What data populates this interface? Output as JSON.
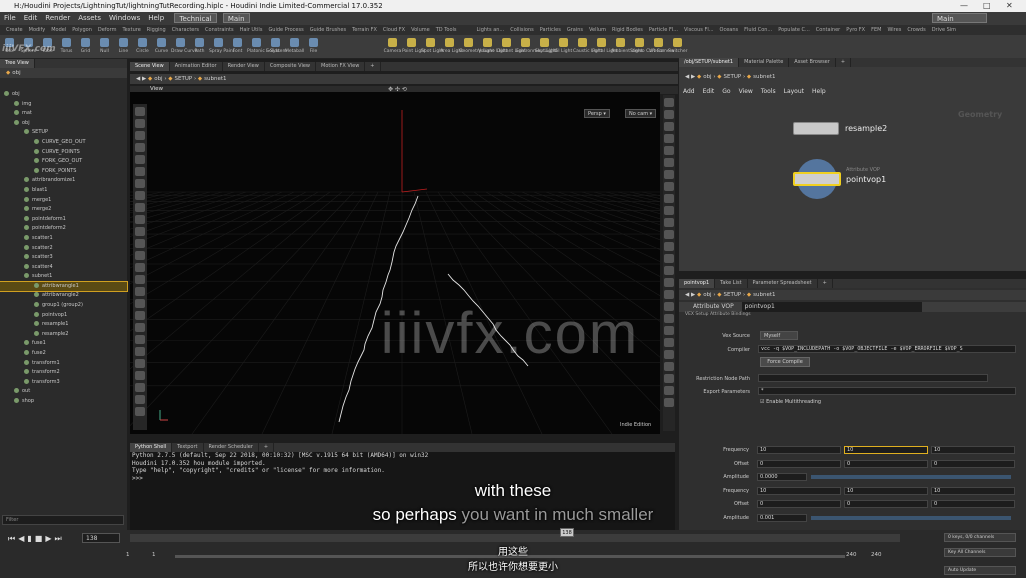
{
  "window": {
    "title": "H:/Houdini Projects/LightningTut/lightningTutRecording.hiplc - Houdini Indie Limited-Commercial 17.0.352",
    "min": "—",
    "max": "□",
    "close": "✕"
  },
  "menu": [
    "File",
    "Edit",
    "Render",
    "Assets",
    "Windows",
    "Help"
  ],
  "desktop_left": "Technical",
  "desktop_main": "Main",
  "desktop_right": "Main",
  "shelf_tabs_left": [
    "Create",
    "Modify",
    "Model",
    "Polygon",
    "Deform",
    "Texture",
    "Rigging",
    "Characters",
    "Constraints",
    "Hair Utils",
    "Guide Process",
    "Guide Brushes",
    "Terrain FX",
    "Cloud FX",
    "Volume",
    "TD Tools"
  ],
  "shelf_tabs_right": [
    "Lights an...",
    "Collisions",
    "Particles",
    "Grains",
    "Vellum",
    "Rigid Bodies",
    "Particle Fl...",
    "Viscous Fl...",
    "Oceans",
    "Fluid Con...",
    "Populate C...",
    "Container",
    "Pyro FX",
    "FEM",
    "Wires",
    "Crowds",
    "Drive Sim"
  ],
  "shelf_tools_left": [
    "Box",
    "Sphere",
    "Tube",
    "Torus",
    "Grid",
    "Null",
    "Line",
    "Circle",
    "Curve",
    "Draw Curve",
    "Path",
    "Spray Paint",
    "Font",
    "Platonic Solids",
    "L-System",
    "Metaball",
    "File"
  ],
  "shelf_tools_right": [
    "Camera",
    "Point Light",
    "Spot Light",
    "Area Light",
    "Geometry Light",
    "Volume Light",
    "Distant Light",
    "Environment Light",
    "Sky Light",
    "GI Light",
    "Caustic Light",
    "Portal Light",
    "Ambient Light",
    "Stereo Camera",
    "VR Camera",
    "Switcher"
  ],
  "tree": {
    "tabs": [
      "Tree View"
    ],
    "path": "obj",
    "rows": [
      "obj",
      "img",
      "mat",
      "obj",
      "SETUP",
      "CURVE_GEO_OUT",
      "CURVE_POINTS",
      "FORK_GEO_OUT",
      "FORK_POINTS",
      "attribrandomize1",
      "blast1",
      "merge1",
      "merge2",
      "pointdeform1",
      "pointdeform2",
      "scatter1",
      "scatter2",
      "scatter3",
      "scatter4",
      "subnet1",
      "attribwrangle1",
      "attribwrangle2",
      "group1 (group2)",
      "pointvop1",
      "resample1",
      "resample2",
      "fuse1",
      "fuse2",
      "transform1",
      "transform2",
      "transform3",
      "out",
      "shop"
    ],
    "filter": "Filter"
  },
  "viewer": {
    "tabs": [
      "Scene View",
      "Animation Editor",
      "Render View",
      "Composite View",
      "Motion FX View"
    ],
    "path": [
      "obj",
      "SETUP",
      "subnet1"
    ],
    "label": "View",
    "persp": "Persp ▾",
    "cam": "No cam ▾",
    "edition": "Indie Edition"
  },
  "python": {
    "tabs": [
      "Python Shell",
      "Textport",
      "Render Scheduler"
    ],
    "lines": [
      "Python 2.7.5 (default, Sep 22 2018, 00:10:32) [MSC v.1915 64 bit (AMD64)] on win32",
      "Houdini 17.0.352 hou module imported.",
      "Type \"help\", \"copyright\", \"credits\" or \"license\" for more information.",
      ">>>"
    ]
  },
  "network": {
    "tabs": [
      "/obj/SETUP/subnet1",
      "Material Palette",
      "Asset Browser"
    ],
    "path": [
      "obj",
      "SETUP",
      "subnet1"
    ],
    "menu": [
      "Add",
      "Edit",
      "Go",
      "View",
      "Tools",
      "Layout",
      "Help"
    ],
    "context": "Geometry",
    "node1": "resample2",
    "node2": "pointvop1",
    "node2_sub": "Attribute VOP"
  },
  "params": {
    "tabs": [
      "pointvop1",
      "Take List",
      "Parameter Spreadsheet"
    ],
    "path": [
      "obj",
      "SETUP",
      "subnet1"
    ],
    "type": "Attribute VOP",
    "name": "pointvop1",
    "subtabs": [
      "VEX Setup",
      "Attribute Bindings"
    ],
    "vex_source_label": "Vex Source",
    "vex_source": "Myself",
    "compiler_label": "Compiler",
    "compiler": "vcc -q $VOP_INCLUDEPATH -o $VOP_OBJECTFILE -e $VOP_ERRORFILE $VOP_S",
    "force_compile": "Force Compile",
    "restriction_label": "Restriction Node Path",
    "export_label": "Export Parameters",
    "export_value": "*",
    "multithreading": "Enable Multithreading",
    "rows": [
      {
        "label": "Frequency",
        "a": "10",
        "b": "10",
        "c": "10"
      },
      {
        "label": "Offset",
        "a": "0",
        "b": "0",
        "c": "0"
      },
      {
        "label": "Amplitude",
        "a": "0.0000",
        "b": "",
        "c": ""
      },
      {
        "label": "Frequency",
        "a": "10",
        "b": "10",
        "c": "10"
      },
      {
        "label": "Offset",
        "a": "0",
        "b": "0",
        "c": "0"
      },
      {
        "label": "Amplitude",
        "a": "0.001",
        "b": "",
        "c": ""
      }
    ]
  },
  "timeline": {
    "frame": "138",
    "start": "1",
    "start2": "1",
    "end": "240",
    "end2": "240",
    "marker": "138",
    "keys_label": "0 keys, 0/0 channels",
    "key_all": "Key All Channels",
    "auto_update": "Auto Update"
  },
  "subtitles": {
    "en1": "with these",
    "en2a": "so perhaps",
    "en2b": "you want in much smaller",
    "zh1": "用这些",
    "zh2": "所以也许你想要更小"
  },
  "watermark": "iiivfx.com",
  "logo": "iiiVFX.com"
}
